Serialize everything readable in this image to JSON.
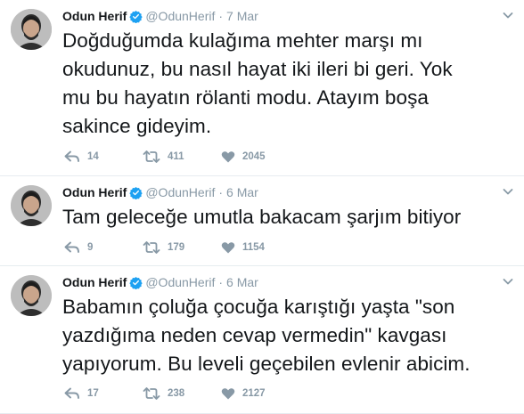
{
  "tweets": [
    {
      "name": "Odun Herif",
      "handle": "@OdunHerif",
      "separator": "·",
      "date": "7 Mar",
      "text": "Doğduğumda kulağıma mehter marşı mı\nokudunuz, bu nasıl hayat iki ileri bi geri. Yok\nmu bu hayatın rölanti modu. Atayım boşa\nsakince gideyim.",
      "replies": "14",
      "retweets": "411",
      "likes": "2045"
    },
    {
      "name": "Odun Herif",
      "handle": "@OdunHerif",
      "separator": "·",
      "date": "6 Mar",
      "text": "Tam geleceğe umutla bakacam şarjım bitiyor",
      "replies": "9",
      "retweets": "179",
      "likes": "1154"
    },
    {
      "name": "Odun Herif",
      "handle": "@OdunHerif",
      "separator": "·",
      "date": "6 Mar",
      "text": "Babamın çoluğa çocuğa karıştığı yaşta \"son\nyazdığıma neden cevap vermedin\" kavgası\nyapıyorum. Bu leveli geçebilen evlenir abicim.",
      "replies": "17",
      "retweets": "238",
      "likes": "2127"
    }
  ],
  "icons": {
    "verified": "verified-badge-icon",
    "caret": "chevron-down-icon",
    "reply": "reply-icon",
    "retweet": "retweet-icon",
    "like": "heart-icon"
  },
  "colors": {
    "text": "#14171a",
    "muted": "#8899a6",
    "verified": "#1da1f2",
    "divider": "#e6ecf0"
  }
}
